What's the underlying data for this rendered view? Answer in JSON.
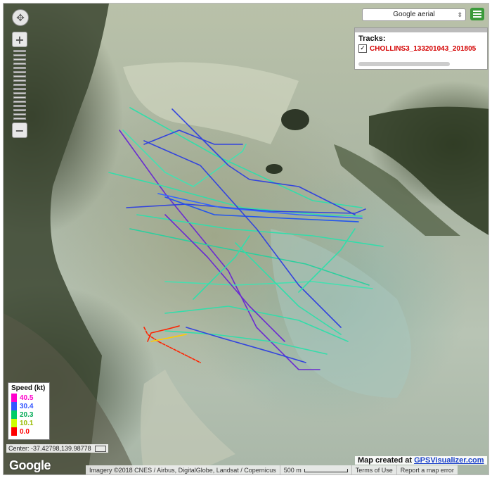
{
  "map": {
    "type_selector": "Google aerial",
    "tracks_title": "Tracks:",
    "track_name": "CHOLLINS3_133201043_201805",
    "track_checked": true,
    "legend": {
      "title": "Speed (kt)",
      "entries": [
        {
          "label": "40.5",
          "color": "#ff00cc"
        },
        {
          "label": "30.4",
          "color": "#3355ff"
        },
        {
          "label": "20.3",
          "color": "#00cc66"
        },
        {
          "label": "10.1",
          "color": "#ccff00"
        },
        {
          "label": "0.0",
          "color": "#ff0000"
        }
      ]
    },
    "center_label": "Center: -37.42798,139.98778",
    "google_logo": "Google",
    "attribution": "Imagery ©2018 CNES / Airbus, DigitalGlobe, Landsat / Copernicus",
    "scale_label": "500 m",
    "terms": "Terms of Use",
    "report": "Report a map error",
    "credit_prefix": "Map created at ",
    "credit_link": "GPSVisualizer.com",
    "track_colors": {
      "slow": "#ff2200",
      "mid": "#33ddaa",
      "fast": "#3344dd",
      "fastest": "#6a2bd0"
    }
  }
}
